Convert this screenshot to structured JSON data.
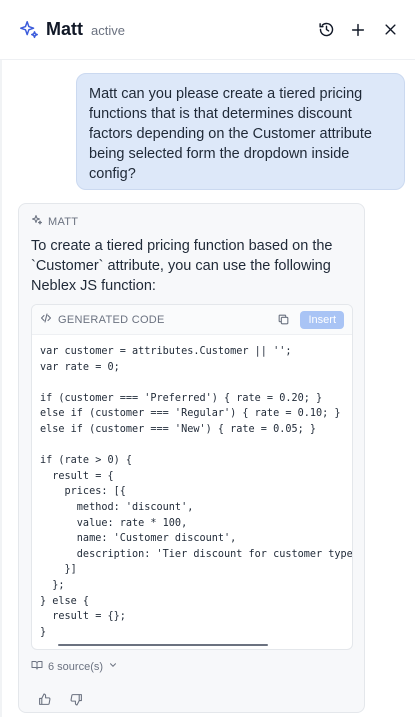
{
  "header": {
    "title": "Matt",
    "status": "active",
    "logo_icon": "sparkle-icon",
    "actions": [
      "history-icon",
      "plus-icon",
      "close-icon"
    ]
  },
  "user_message": {
    "text": "Matt can you please create a tiered pricing functions that is that determines discount factors depending on the Customer attribute being selected form the dropdown inside config?"
  },
  "bot_message": {
    "label": "MATT",
    "text": "To create a tiered pricing function based on the `Customer` attribute, you can use the following Neblex JS function:",
    "code_block": {
      "title": "GENERATED CODE",
      "insert_label": "Insert",
      "code": "var customer = attributes.Customer || '';\nvar rate = 0;\n\nif (customer === 'Preferred') { rate = 0.20; }\nelse if (customer === 'Regular') { rate = 0.10; }\nelse if (customer === 'New') { rate = 0.05; }\n\nif (rate > 0) {\n  result = {\n    prices: [{\n      method: 'discount',\n      value: rate * 100,\n      name: 'Customer discount',\n      description: 'Tier discount for customer type\n    }]\n  };\n} else {\n  result = {};\n}"
    },
    "sources_label": "6 source(s)"
  },
  "colors": {
    "user_bubble": "#dde8f9",
    "insert_button": "#a9c4f5",
    "accent": "#3b5bdb"
  }
}
